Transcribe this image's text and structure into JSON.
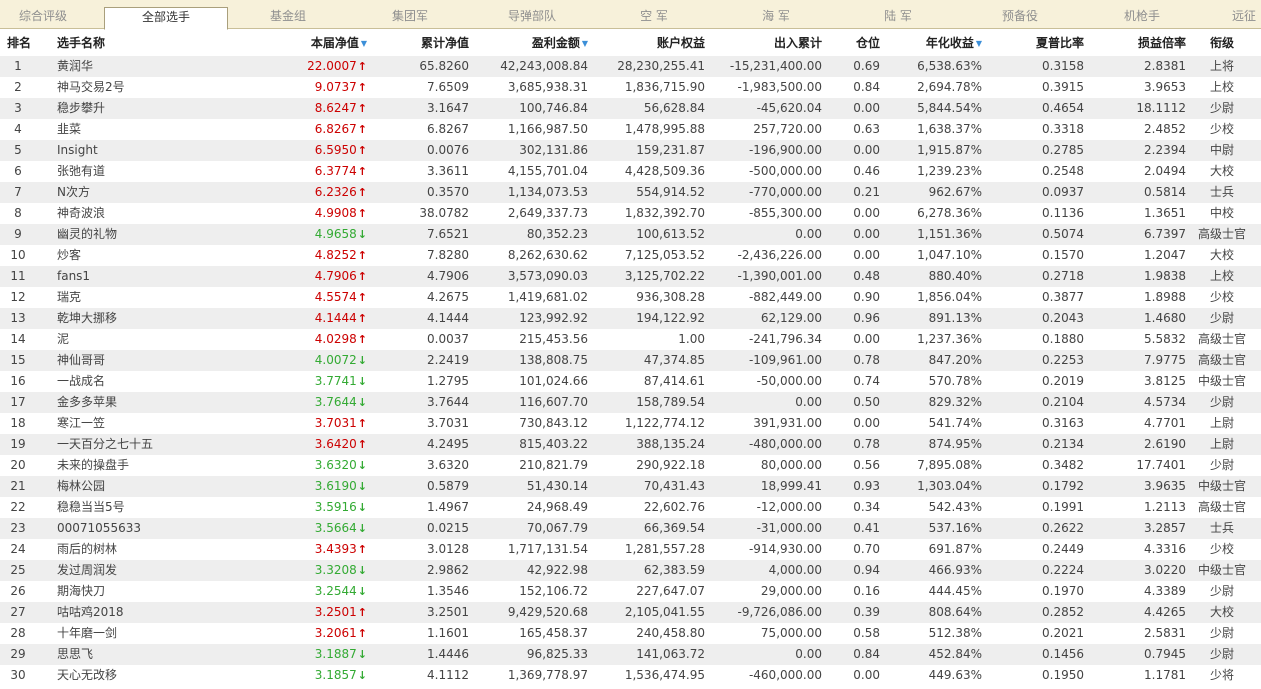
{
  "tabs": [
    {
      "label": "综合评级",
      "active": false
    },
    {
      "label": "全部选手",
      "active": true
    },
    {
      "label": "基金组",
      "active": false
    },
    {
      "label": "集团军",
      "active": false
    },
    {
      "label": "导弹部队",
      "active": false
    },
    {
      "label": "空 军",
      "active": false
    },
    {
      "label": "海 军",
      "active": false
    },
    {
      "label": "陆 军",
      "active": false
    },
    {
      "label": "预备役",
      "active": false
    },
    {
      "label": "机枪手",
      "active": false
    },
    {
      "label": "远征",
      "active": false
    }
  ],
  "columns": {
    "rank": "排名",
    "name": "选手名称",
    "nav": "本届净值",
    "cum_nav": "累计净值",
    "profit": "盈利金额",
    "equity": "账户权益",
    "flow": "出入累计",
    "position": "仓位",
    "annual": "年化收益",
    "sharpe": "夏普比率",
    "pl_ratio": "损益倍率",
    "title": "衔级"
  },
  "sorted_columns": [
    "nav",
    "profit",
    "annual"
  ],
  "colors": {
    "up": "#cc0000",
    "down": "#33aa33",
    "sort_arrow": "#3c8fd8",
    "tab_bar": "#f7f1da",
    "row_stripe": "#eeeeee"
  },
  "rows": [
    {
      "rank": "1",
      "name": "黄润华",
      "nav": "22.0007",
      "trend": "up",
      "cum_nav": "65.8260",
      "profit": "42,243,008.84",
      "equity": "28,230,255.41",
      "flow": "-15,231,400.00",
      "position": "0.69",
      "annual": "6,538.63%",
      "sharpe": "0.3158",
      "pl_ratio": "2.8381",
      "title": "上将"
    },
    {
      "rank": "2",
      "name": "神马交易2号",
      "nav": "9.0737",
      "trend": "up",
      "cum_nav": "7.6509",
      "profit": "3,685,938.31",
      "equity": "1,836,715.90",
      "flow": "-1,983,500.00",
      "position": "0.84",
      "annual": "2,694.78%",
      "sharpe": "0.3915",
      "pl_ratio": "3.9653",
      "title": "上校"
    },
    {
      "rank": "3",
      "name": "稳步攀升",
      "nav": "8.6247",
      "trend": "up",
      "cum_nav": "3.1647",
      "profit": "100,746.84",
      "equity": "56,628.84",
      "flow": "-45,620.04",
      "position": "0.00",
      "annual": "5,844.54%",
      "sharpe": "0.4654",
      "pl_ratio": "18.1112",
      "title": "少尉"
    },
    {
      "rank": "4",
      "name": "韭菜",
      "nav": "6.8267",
      "trend": "up",
      "cum_nav": "6.8267",
      "profit": "1,166,987.50",
      "equity": "1,478,995.88",
      "flow": "257,720.00",
      "position": "0.63",
      "annual": "1,638.37%",
      "sharpe": "0.3318",
      "pl_ratio": "2.4852",
      "title": "少校"
    },
    {
      "rank": "5",
      "name": "Insight",
      "nav": "6.5950",
      "trend": "up",
      "cum_nav": "0.0076",
      "profit": "302,131.86",
      "equity": "159,231.87",
      "flow": "-196,900.00",
      "position": "0.00",
      "annual": "1,915.87%",
      "sharpe": "0.2785",
      "pl_ratio": "2.2394",
      "title": "中尉"
    },
    {
      "rank": "6",
      "name": "张弛有道",
      "nav": "6.3774",
      "trend": "up",
      "cum_nav": "3.3611",
      "profit": "4,155,701.04",
      "equity": "4,428,509.36",
      "flow": "-500,000.00",
      "position": "0.46",
      "annual": "1,239.23%",
      "sharpe": "0.2548",
      "pl_ratio": "2.0494",
      "title": "大校"
    },
    {
      "rank": "7",
      "name": "N次方",
      "nav": "6.2326",
      "trend": "up",
      "cum_nav": "0.3570",
      "profit": "1,134,073.53",
      "equity": "554,914.52",
      "flow": "-770,000.00",
      "position": "0.21",
      "annual": "962.67%",
      "sharpe": "0.0937",
      "pl_ratio": "0.5814",
      "title": "士兵"
    },
    {
      "rank": "8",
      "name": "神奇波浪",
      "nav": "4.9908",
      "trend": "up",
      "cum_nav": "38.0782",
      "profit": "2,649,337.73",
      "equity": "1,832,392.70",
      "flow": "-855,300.00",
      "position": "0.00",
      "annual": "6,278.36%",
      "sharpe": "0.1136",
      "pl_ratio": "1.3651",
      "title": "中校"
    },
    {
      "rank": "9",
      "name": "幽灵的礼物",
      "nav": "4.9658",
      "trend": "down",
      "cum_nav": "7.6521",
      "profit": "80,352.23",
      "equity": "100,613.52",
      "flow": "0.00",
      "position": "0.00",
      "annual": "1,151.36%",
      "sharpe": "0.5074",
      "pl_ratio": "6.7397",
      "title": "高级士官"
    },
    {
      "rank": "10",
      "name": "炒客",
      "nav": "4.8252",
      "trend": "up",
      "cum_nav": "7.8280",
      "profit": "8,262,630.62",
      "equity": "7,125,053.52",
      "flow": "-2,436,226.00",
      "position": "0.00",
      "annual": "1,047.10%",
      "sharpe": "0.1570",
      "pl_ratio": "1.2047",
      "title": "大校"
    },
    {
      "rank": "11",
      "name": "fans1",
      "nav": "4.7906",
      "trend": "up",
      "cum_nav": "4.7906",
      "profit": "3,573,090.03",
      "equity": "3,125,702.22",
      "flow": "-1,390,001.00",
      "position": "0.48",
      "annual": "880.40%",
      "sharpe": "0.2718",
      "pl_ratio": "1.9838",
      "title": "上校"
    },
    {
      "rank": "12",
      "name": "瑞克",
      "nav": "4.5574",
      "trend": "up",
      "cum_nav": "4.2675",
      "profit": "1,419,681.02",
      "equity": "936,308.28",
      "flow": "-882,449.00",
      "position": "0.90",
      "annual": "1,856.04%",
      "sharpe": "0.3877",
      "pl_ratio": "1.8988",
      "title": "少校"
    },
    {
      "rank": "13",
      "name": "乾坤大挪移",
      "nav": "4.1444",
      "trend": "up",
      "cum_nav": "4.1444",
      "profit": "123,992.92",
      "equity": "194,122.92",
      "flow": "62,129.00",
      "position": "0.96",
      "annual": "891.13%",
      "sharpe": "0.2043",
      "pl_ratio": "1.4680",
      "title": "少尉"
    },
    {
      "rank": "14",
      "name": "泥",
      "nav": "4.0298",
      "trend": "up",
      "cum_nav": "0.0037",
      "profit": "215,453.56",
      "equity": "1.00",
      "flow": "-241,796.34",
      "position": "0.00",
      "annual": "1,237.36%",
      "sharpe": "0.1880",
      "pl_ratio": "5.5832",
      "title": "高级士官"
    },
    {
      "rank": "15",
      "name": "神仙哥哥",
      "nav": "4.0072",
      "trend": "down",
      "cum_nav": "2.2419",
      "profit": "138,808.75",
      "equity": "47,374.85",
      "flow": "-109,961.00",
      "position": "0.78",
      "annual": "847.20%",
      "sharpe": "0.2253",
      "pl_ratio": "7.9775",
      "title": "高级士官"
    },
    {
      "rank": "16",
      "name": "一战成名",
      "nav": "3.7741",
      "trend": "down",
      "cum_nav": "1.2795",
      "profit": "101,024.66",
      "equity": "87,414.61",
      "flow": "-50,000.00",
      "position": "0.74",
      "annual": "570.78%",
      "sharpe": "0.2019",
      "pl_ratio": "3.8125",
      "title": "中级士官"
    },
    {
      "rank": "17",
      "name": "金多多苹果",
      "nav": "3.7644",
      "trend": "down",
      "cum_nav": "3.7644",
      "profit": "116,607.70",
      "equity": "158,789.54",
      "flow": "0.00",
      "position": "0.50",
      "annual": "829.32%",
      "sharpe": "0.2104",
      "pl_ratio": "4.5734",
      "title": "少尉"
    },
    {
      "rank": "18",
      "name": "寒江一笠",
      "nav": "3.7031",
      "trend": "up",
      "cum_nav": "3.7031",
      "profit": "730,843.12",
      "equity": "1,122,774.12",
      "flow": "391,931.00",
      "position": "0.00",
      "annual": "541.74%",
      "sharpe": "0.3163",
      "pl_ratio": "4.7701",
      "title": "上尉"
    },
    {
      "rank": "19",
      "name": "一天百分之七十五",
      "nav": "3.6420",
      "trend": "up",
      "cum_nav": "4.2495",
      "profit": "815,403.22",
      "equity": "388,135.24",
      "flow": "-480,000.00",
      "position": "0.78",
      "annual": "874.95%",
      "sharpe": "0.2134",
      "pl_ratio": "2.6190",
      "title": "上尉"
    },
    {
      "rank": "20",
      "name": "未来的操盘手",
      "nav": "3.6320",
      "trend": "down",
      "cum_nav": "3.6320",
      "profit": "210,821.79",
      "equity": "290,922.18",
      "flow": "80,000.00",
      "position": "0.56",
      "annual": "7,895.08%",
      "sharpe": "0.3482",
      "pl_ratio": "17.7401",
      "title": "少尉"
    },
    {
      "rank": "21",
      "name": "梅林公园",
      "nav": "3.6190",
      "trend": "down",
      "cum_nav": "0.5879",
      "profit": "51,430.14",
      "equity": "70,431.43",
      "flow": "18,999.41",
      "position": "0.93",
      "annual": "1,303.04%",
      "sharpe": "0.1792",
      "pl_ratio": "3.9635",
      "title": "中级士官"
    },
    {
      "rank": "22",
      "name": "稳稳当当5号",
      "nav": "3.5916",
      "trend": "down",
      "cum_nav": "1.4967",
      "profit": "24,968.49",
      "equity": "22,602.76",
      "flow": "-12,000.00",
      "position": "0.34",
      "annual": "542.43%",
      "sharpe": "0.1991",
      "pl_ratio": "1.2113",
      "title": "高级士官"
    },
    {
      "rank": "23",
      "name": "00071055633",
      "nav": "3.5664",
      "trend": "down",
      "cum_nav": "0.0215",
      "profit": "70,067.79",
      "equity": "66,369.54",
      "flow": "-31,000.00",
      "position": "0.41",
      "annual": "537.16%",
      "sharpe": "0.2622",
      "pl_ratio": "3.2857",
      "title": "士兵"
    },
    {
      "rank": "24",
      "name": "雨后的树林",
      "nav": "3.4393",
      "trend": "up",
      "cum_nav": "3.0128",
      "profit": "1,717,131.54",
      "equity": "1,281,557.28",
      "flow": "-914,930.00",
      "position": "0.70",
      "annual": "691.87%",
      "sharpe": "0.2449",
      "pl_ratio": "4.3316",
      "title": "少校"
    },
    {
      "rank": "25",
      "name": "发过周润发",
      "nav": "3.3208",
      "trend": "down",
      "cum_nav": "2.9862",
      "profit": "42,922.98",
      "equity": "62,383.59",
      "flow": "4,000.00",
      "position": "0.94",
      "annual": "466.93%",
      "sharpe": "0.2224",
      "pl_ratio": "3.0220",
      "title": "中级士官"
    },
    {
      "rank": "26",
      "name": "期海快刀",
      "nav": "3.2544",
      "trend": "down",
      "cum_nav": "1.3546",
      "profit": "152,106.72",
      "equity": "227,647.07",
      "flow": "29,000.00",
      "position": "0.16",
      "annual": "444.45%",
      "sharpe": "0.1970",
      "pl_ratio": "4.3389",
      "title": "少尉"
    },
    {
      "rank": "27",
      "name": "咕咕鸡2018",
      "nav": "3.2501",
      "trend": "up",
      "cum_nav": "3.2501",
      "profit": "9,429,520.68",
      "equity": "2,105,041.55",
      "flow": "-9,726,086.00",
      "position": "0.39",
      "annual": "808.64%",
      "sharpe": "0.2852",
      "pl_ratio": "4.4265",
      "title": "大校"
    },
    {
      "rank": "28",
      "name": "十年磨一剑",
      "nav": "3.2061",
      "trend": "up",
      "cum_nav": "1.1601",
      "profit": "165,458.37",
      "equity": "240,458.80",
      "flow": "75,000.00",
      "position": "0.58",
      "annual": "512.38%",
      "sharpe": "0.2021",
      "pl_ratio": "2.5831",
      "title": "少尉"
    },
    {
      "rank": "29",
      "name": "思思飞",
      "nav": "3.1887",
      "trend": "down",
      "cum_nav": "1.4446",
      "profit": "96,825.33",
      "equity": "141,063.72",
      "flow": "0.00",
      "position": "0.84",
      "annual": "452.84%",
      "sharpe": "0.1456",
      "pl_ratio": "0.7945",
      "title": "少尉"
    },
    {
      "rank": "30",
      "name": "天心无改移",
      "nav": "3.1857",
      "trend": "down",
      "cum_nav": "4.1112",
      "profit": "1,369,778.97",
      "equity": "1,536,474.95",
      "flow": "-460,000.00",
      "position": "0.00",
      "annual": "449.63%",
      "sharpe": "0.1950",
      "pl_ratio": "1.1781",
      "title": "少将"
    }
  ]
}
